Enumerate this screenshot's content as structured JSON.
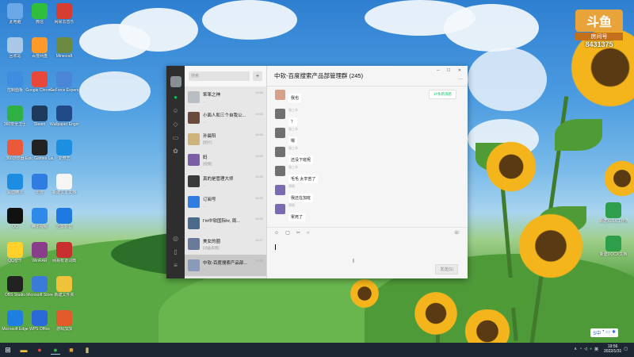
{
  "desktop": {
    "icons": [
      {
        "label": "此电脑",
        "color": "#6aa8e8"
      },
      {
        "label": "微信",
        "color": "#2fbf3a"
      },
      {
        "label": "网易云音乐",
        "color": "#d63c2f"
      },
      {
        "label": "回收站",
        "color": "#a9c8e8"
      },
      {
        "label": "百度网盘",
        "color": "#ff9a2a"
      },
      {
        "label": "Minecraft",
        "color": "#6c8a3f"
      },
      {
        "label": "控制面板",
        "color": "#3f8de0"
      },
      {
        "label": "Google Chrome",
        "color": "#e8473a"
      },
      {
        "label": "GeForce Experience",
        "color": "#4a86d8"
      },
      {
        "label": "360安全卫士",
        "color": "#2fb044"
      },
      {
        "label": "Steam",
        "color": "#1e3a5c"
      },
      {
        "label": "Wallpaper Engine",
        "color": "#204a88"
      },
      {
        "label": "360浏览器",
        "color": "#ea5a3a"
      },
      {
        "label": "Epic Games Launcher",
        "color": "#222222"
      },
      {
        "label": "爱奇艺",
        "color": "#1d8fe0"
      },
      {
        "label": "驱动精灵",
        "color": "#1c8de0"
      },
      {
        "label": "迅雷",
        "color": "#2f7de0"
      },
      {
        "label": "新建文本文档",
        "color": "#f5f5f5"
      },
      {
        "label": "QQ",
        "color": "#111111"
      },
      {
        "label": "腾讯视频",
        "color": "#2e89e8"
      },
      {
        "label": "迅雷影音",
        "color": "#1e7ae0"
      },
      {
        "label": "QQ音乐",
        "color": "#ffd12a"
      },
      {
        "label": "WinRAR",
        "color": "#8a3d8a"
      },
      {
        "label": "网易有道词典",
        "color": "#c82f2f"
      },
      {
        "label": "OBS Studio",
        "color": "#222222"
      },
      {
        "label": "Microsoft Store",
        "color": "#3a7ad8"
      },
      {
        "label": "新建文件夹",
        "color": "#f0c23a"
      },
      {
        "label": "Microsoft Edge",
        "color": "#1f7fe0"
      },
      {
        "label": "WPS Office",
        "color": "#2a6ad8"
      },
      {
        "label": "游戏加加",
        "color": "#e25a2a"
      }
    ],
    "right_icons": [
      {
        "label": "新建XLSX工作表",
        "color": "#2f9e4a"
      },
      {
        "label": "新建DOCX文档",
        "color": "#2f9e4a"
      }
    ]
  },
  "watermark": {
    "logo": "斗鱼",
    "sub": "房间号",
    "room_number": "8431375"
  },
  "wechat": {
    "search_placeholder": "搜索",
    "add_label": "+",
    "title": "中软-百度搜索产品部管理群 (245)",
    "new_message_notice": "17条新消息",
    "send_label": "发送(S)",
    "chats": [
      {
        "name": "笨笨之神",
        "preview": "…",
        "time": "19:56",
        "color": "#b9bec4"
      },
      {
        "name": "小面人和三个自我公...",
        "preview": "…",
        "time": "19:55",
        "color": "#6a4a3a"
      },
      {
        "name": "孙晨阳",
        "preview": "[图片]",
        "time": "19:54",
        "color": "#cdb27a"
      },
      {
        "name": "妈",
        "preview": "[视频]",
        "time": "19:50",
        "color": "#7b5ea7"
      },
      {
        "name": "真的是管理大师",
        "preview": "…",
        "time": "19:40",
        "color": "#3a3a3a"
      },
      {
        "name": "订阅号",
        "preview": "…",
        "time": "19:32",
        "color": "#2f7de0"
      },
      {
        "name": "I'm中软国际hr, 周...",
        "preview": "…",
        "time": "19:30",
        "color": "#4a6a8a"
      },
      {
        "name": "美女的圈",
        "preview": "[动画表情]",
        "time": "19:27",
        "color": "#6a7a9a"
      },
      {
        "name": "中软-百度搜索产品部...",
        "preview": "…",
        "time": "19:25",
        "color": "#8a9aba"
      }
    ],
    "messages": [
      {
        "sender": "",
        "text": "我也",
        "color": "#d7a088"
      },
      {
        "sender": "张三丰",
        "text": "？",
        "color": "#707070"
      },
      {
        "sender": "张三丰",
        "text": "嗯",
        "color": "#707070"
      },
      {
        "sender": "张三丰",
        "text": "还没下班呢",
        "color": "#707070"
      },
      {
        "sender": "张三丰",
        "text": "毛毛  太辛苦了",
        "color": "#707070"
      },
      {
        "sender": "郑雨",
        "text": "我还在加班",
        "color": "#7a6ab0"
      },
      {
        "sender": "郑雨",
        "text": "累死了",
        "color": "#7a6ab0"
      }
    ]
  },
  "tray": {
    "ime_label": "S中",
    "time": "19:56",
    "date": "2022/1/31"
  }
}
